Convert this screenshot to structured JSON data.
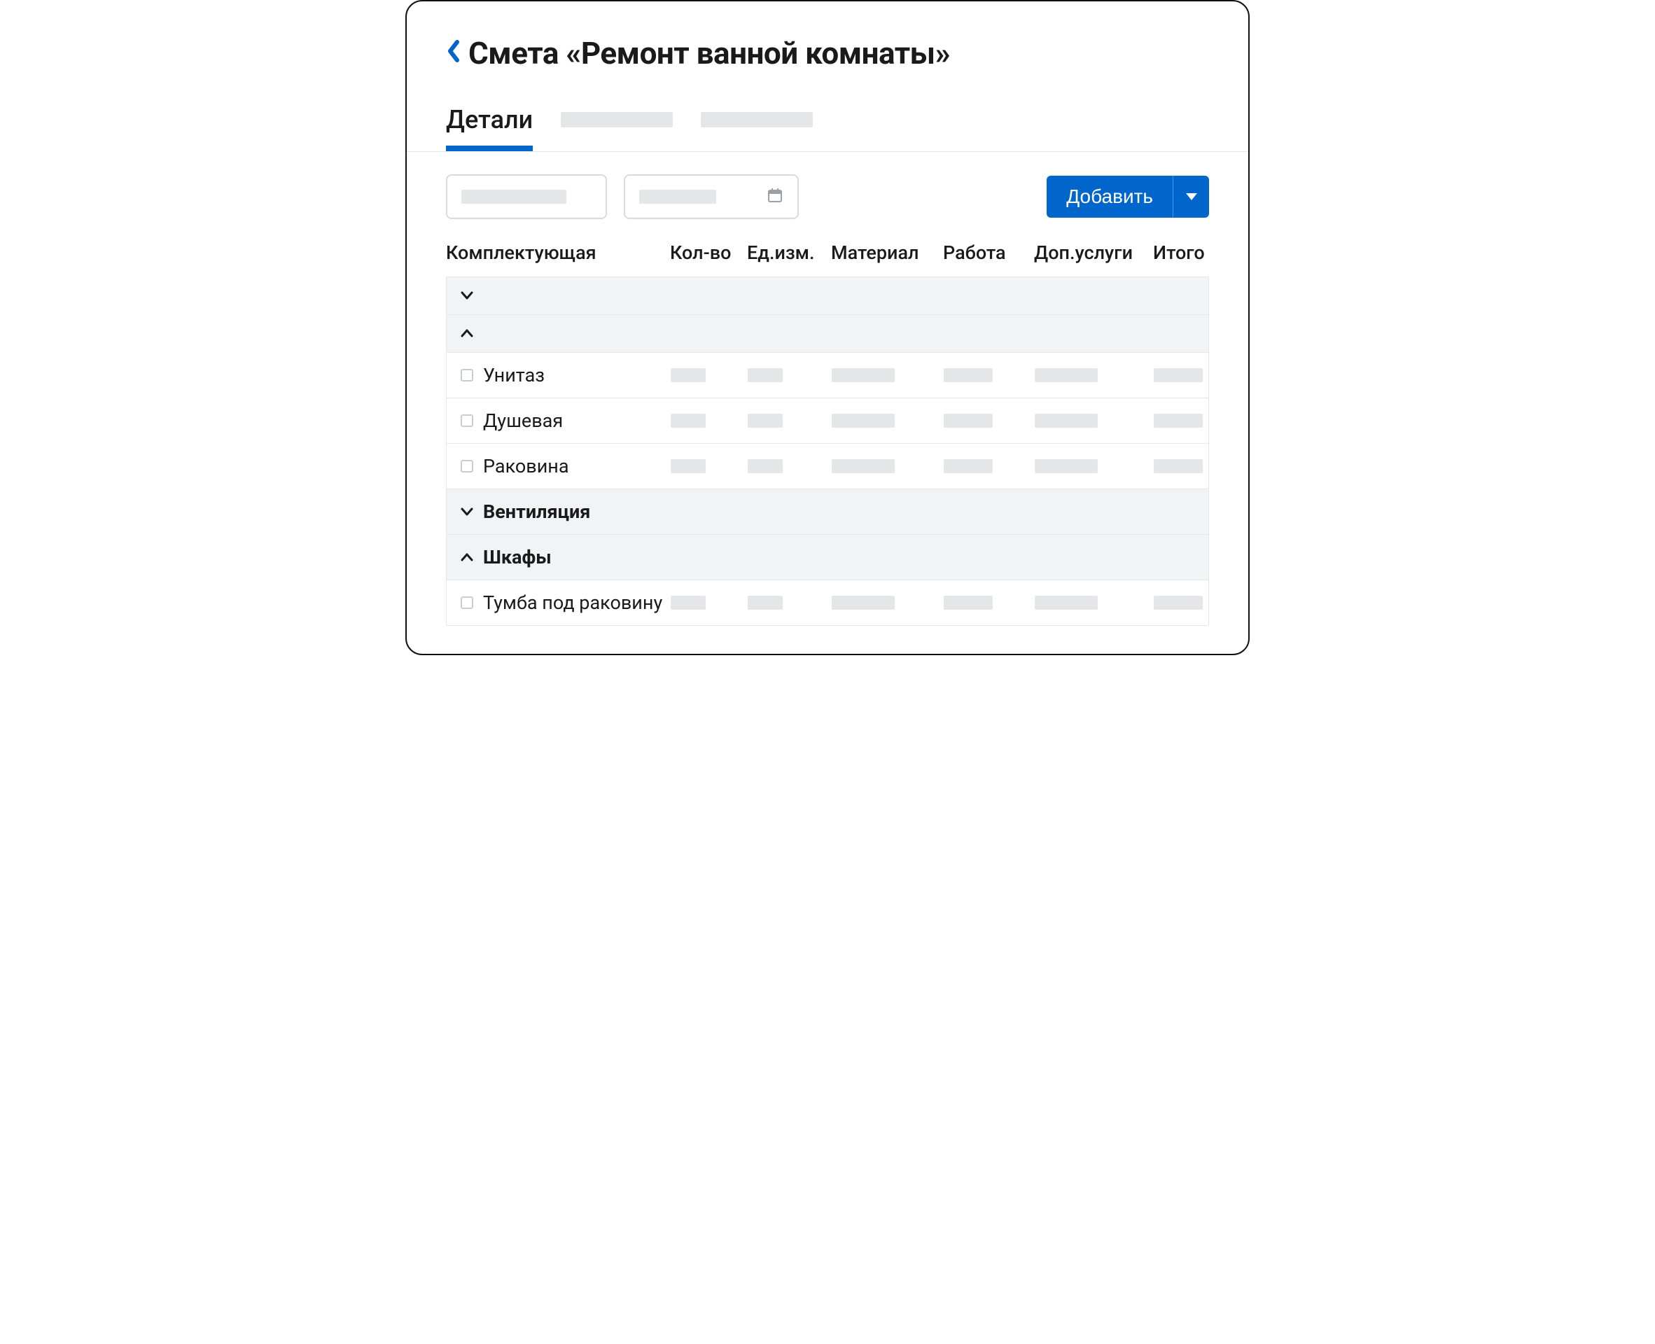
{
  "header": {
    "title": "Смета «Ремонт ванной комнаты»"
  },
  "tabs": {
    "active": "Детали"
  },
  "toolbar": {
    "add_label": "Добавить"
  },
  "table": {
    "columns": {
      "component": "Комплектующая",
      "qty": "Кол-во",
      "unit": "Ед.изм.",
      "material": "Материал",
      "work": "Работа",
      "services": "Доп.услуги",
      "total": "Итого"
    },
    "groups": [
      {
        "name": "",
        "expanded": false,
        "items": []
      },
      {
        "name": "",
        "expanded": true,
        "items": [
          {
            "name": "Унитаз"
          },
          {
            "name": "Душевая"
          },
          {
            "name": "Раковина"
          }
        ]
      },
      {
        "name": "Вентиляция",
        "expanded": false,
        "items": []
      },
      {
        "name": "Шкафы",
        "expanded": true,
        "items": [
          {
            "name": "Тумба под раковину"
          }
        ]
      }
    ]
  }
}
